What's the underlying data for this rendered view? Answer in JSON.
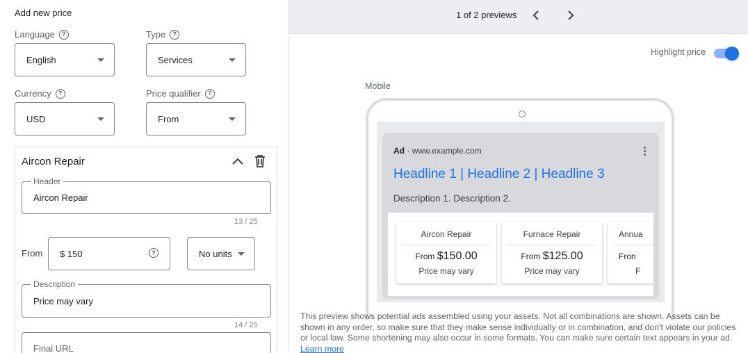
{
  "form": {
    "title": "Add new price",
    "language": {
      "label": "Language",
      "value": "English"
    },
    "type": {
      "label": "Type",
      "value": "Services"
    },
    "currency": {
      "label": "Currency",
      "value": "USD"
    },
    "qualifier": {
      "label": "Price qualifier",
      "value": "From"
    },
    "item": {
      "title": "Aircon Repair",
      "header": {
        "label": "Header",
        "value": "Aircon Repair",
        "counter": "13 / 25"
      },
      "price_prefix": "From",
      "price": {
        "value": "$ 150"
      },
      "units": {
        "value": "No units"
      },
      "description": {
        "label": "Description",
        "value": "Price may vary",
        "counter": "14 / 25"
      },
      "final_url": {
        "placeholder": "Final URL"
      }
    }
  },
  "preview": {
    "pager_text": "1 of 2 previews",
    "highlight_label": "Highlight price",
    "highlight_on": true,
    "mobile_label": "Mobile",
    "ad": {
      "badge": "Ad",
      "separator": "·",
      "url": "www.example.com",
      "headline": "Headline 1 | Headline 2 | Headline 3",
      "description": "Description 1. Description 2.",
      "cards": [
        {
          "header": "Aircon Repair",
          "prefix": "From",
          "price": "$150.00",
          "note": "Price may vary"
        },
        {
          "header": "Furnace Repair",
          "prefix": "From",
          "price": "$125.00",
          "note": "Price may vary"
        },
        {
          "header": "Annua",
          "prefix": "Fron",
          "price": "",
          "note": "F"
        }
      ]
    },
    "disclaimer": "This preview shows potential ads assembled using your assets. Not all combinations are shown. Assets can be shown in any order, so make sure that they make sense individually or in combination, and don't violate our policies or local law. Some shortening may also occur in some formats. You can make sure certain text appears in your ad.",
    "learn_more": "Learn more"
  },
  "colors": {
    "accent": "#1a73e8",
    "toggle_track": "#8ab4f8",
    "topbar": "#eceef1"
  },
  "icons": [
    "help-icon",
    "dropdown-caret-icon",
    "chevron-up-icon",
    "trash-icon",
    "chevron-left-icon",
    "chevron-right-icon",
    "more-vert-icon"
  ]
}
